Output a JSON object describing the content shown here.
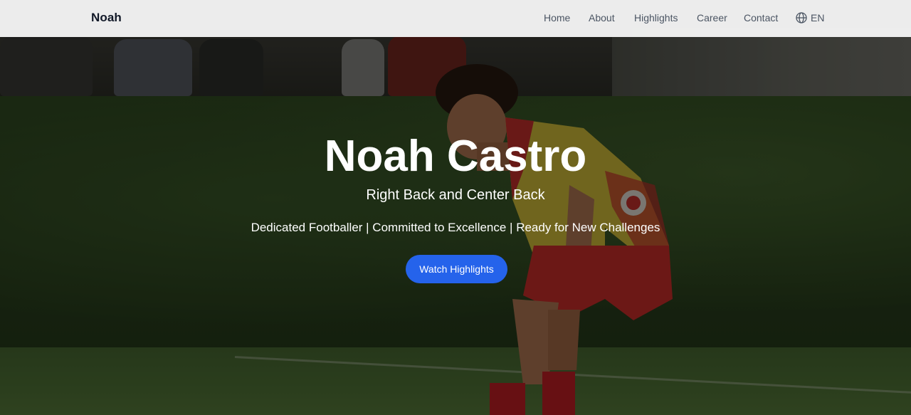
{
  "nav": {
    "brand": "Noah",
    "links": [
      {
        "label": "Home"
      },
      {
        "label": "About"
      },
      {
        "label": "Highlights"
      },
      {
        "label": "Career"
      },
      {
        "label": "Contact"
      }
    ],
    "language": {
      "icon": "globe-icon",
      "label": "EN"
    }
  },
  "hero": {
    "title": "Noah Castro",
    "subtitle": "Right Back and Center Back",
    "tagline": "Dedicated Footballer | Committed to Excellence | Ready for New Challenges",
    "cta_label": "Watch Highlights"
  },
  "colors": {
    "accent": "#2563eb",
    "navbar_bg": "#f5f5f5",
    "brand_text": "#111827",
    "nav_text": "#4b5563",
    "hero_text": "#ffffff"
  }
}
